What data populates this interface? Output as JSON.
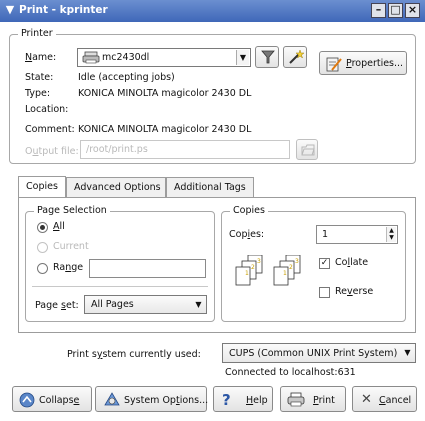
{
  "window": {
    "title": "Print - kprinter"
  },
  "printer": {
    "legend": "Printer",
    "name_label": "Name:",
    "name_value": "mc2430dl",
    "properties_label": "Properties...",
    "state_label": "State:",
    "state_value": "Idle (accepting jobs)",
    "type_label": "Type:",
    "type_value": "KONICA MINOLTA magicolor 2430 DL",
    "location_label": "Location:",
    "location_value": "",
    "comment_label": "Comment:",
    "comment_value": "KONICA MINOLTA magicolor 2430 DL",
    "output_file_label": "Output file:",
    "output_file_value": "/root/print.ps"
  },
  "tabs": [
    {
      "label": "Copies",
      "active": true
    },
    {
      "label": "Advanced Options",
      "active": false
    },
    {
      "label": "Additional Tags",
      "active": false
    }
  ],
  "page_selection": {
    "legend": "Page Selection",
    "all_label": "All",
    "current_label": "Current",
    "range_label": "Range",
    "range_value": "",
    "page_set_label": "Page set:",
    "page_set_value": "All Pages"
  },
  "copies": {
    "legend": "Copies",
    "copies_label": "Copies:",
    "copies_value": "1",
    "collate_label": "Collate",
    "collate_checked": true,
    "reverse_label": "Reverse",
    "reverse_checked": false
  },
  "system": {
    "label": "Print system currently used:",
    "value": "CUPS (Common UNIX Print System)",
    "connection": "Connected to localhost:631"
  },
  "buttons": {
    "collapse": "Collapse",
    "system_options": "System Options...",
    "help": "Help",
    "print": "Print",
    "cancel": "Cancel"
  },
  "icons": {
    "printer": "printer-icon",
    "filter": "filter-icon",
    "wizard": "wand-icon",
    "properties": "properties-icon",
    "file_browse": "folder-icon",
    "collapse": "collapse-icon",
    "system_options": "options-icon",
    "help": "help-icon",
    "print": "print-icon",
    "cancel": "cancel-icon"
  }
}
